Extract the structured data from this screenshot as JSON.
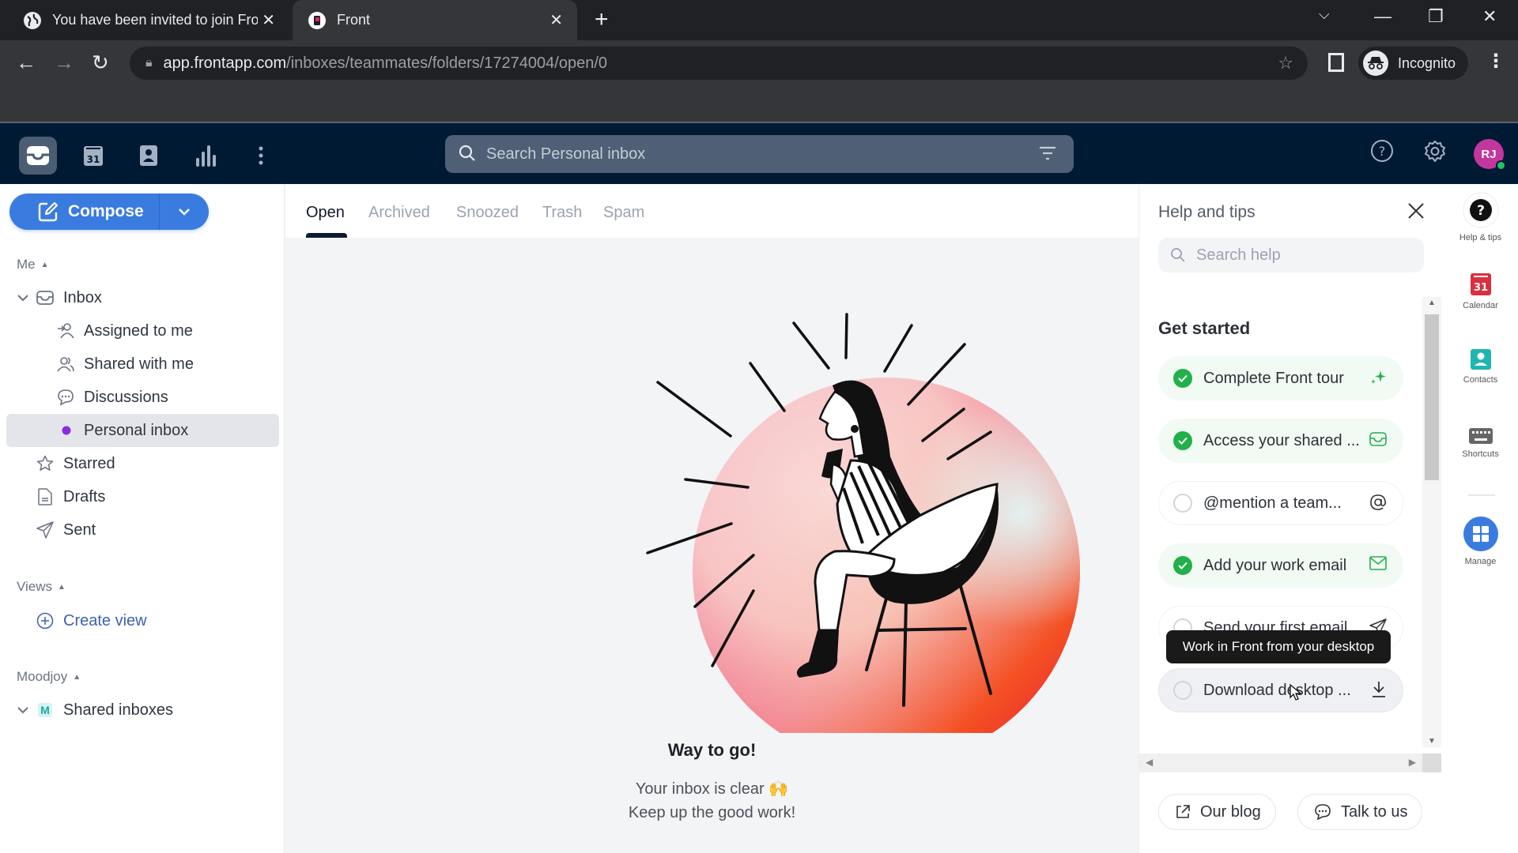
{
  "browser": {
    "tabs": [
      {
        "title": "You have been invited to join Front",
        "favicon": "globe-icon",
        "active": false
      },
      {
        "title": "Front",
        "favicon": "front-logo-icon",
        "active": true
      }
    ],
    "url_host": "app.frontapp.com",
    "url_path": "/inboxes/teammates/folders/17274004/open/0",
    "profile_label": "Incognito"
  },
  "header": {
    "search_placeholder": "Search Personal inbox",
    "avatar_initials": "RJ",
    "calendar_day": "31"
  },
  "sidebar": {
    "compose_label": "Compose",
    "sections": {
      "me": "Me",
      "views": "Views",
      "moodjoy": "Moodjoy"
    },
    "items": [
      {
        "label": "Inbox",
        "icon": "inbox-icon"
      },
      {
        "label": "Assigned to me",
        "icon": "assigned-icon"
      },
      {
        "label": "Shared with me",
        "icon": "shared-icon"
      },
      {
        "label": "Discussions",
        "icon": "discussions-icon"
      },
      {
        "label": "Personal inbox",
        "icon": "purple-dot-icon",
        "selected": true
      },
      {
        "label": "Starred",
        "icon": "star-icon"
      },
      {
        "label": "Drafts",
        "icon": "drafts-icon"
      },
      {
        "label": "Sent",
        "icon": "sent-icon"
      }
    ],
    "create_view_label": "Create view",
    "shared_inboxes_label": "Shared inboxes",
    "shared_inboxes_badge": "M"
  },
  "main": {
    "tabs": [
      {
        "label": "Open",
        "active": true
      },
      {
        "label": "Archived"
      },
      {
        "label": "Snoozed"
      },
      {
        "label": "Trash"
      },
      {
        "label": "Spam"
      }
    ],
    "empty_title": "Way to go!",
    "empty_line1": "Your inbox is clear 🙌",
    "empty_line2": "Keep up the good work!"
  },
  "help_panel": {
    "title": "Help and tips",
    "search_placeholder": "Search help",
    "section_title": "Get started",
    "tasks": [
      {
        "label": "Complete Front tour",
        "done": true,
        "icon": "sparkle-icon"
      },
      {
        "label": "Access your shared ...",
        "done": true,
        "icon": "inbox-icon"
      },
      {
        "label": "@mention a team...",
        "done": false,
        "icon": "at-icon"
      },
      {
        "label": "Add your work email",
        "done": true,
        "icon": "mail-icon"
      },
      {
        "label": "Send your first email",
        "done": false,
        "icon": "send-icon"
      },
      {
        "label": "Download desktop ...",
        "done": false,
        "icon": "download-icon"
      }
    ],
    "tooltip": "Work in Front from your desktop",
    "blog_label": "Our blog",
    "talk_label": "Talk to us"
  },
  "rail": {
    "items": [
      {
        "label": "Help & tips",
        "icon": "help-icon"
      },
      {
        "label": "Calendar",
        "icon": "calendar-icon",
        "badge": "31"
      },
      {
        "label": "Contacts",
        "icon": "contacts-icon"
      },
      {
        "label": "Shortcuts",
        "icon": "keyboard-icon"
      },
      {
        "label": "Manage",
        "icon": "grid-icon"
      }
    ]
  },
  "colors": {
    "header_bg": "#011a33",
    "compose_blue": "#3a7be0",
    "success_green": "#22b04b",
    "avatar_pink": "#c2369e",
    "personal_inbox_dot": "#8a2be2"
  }
}
